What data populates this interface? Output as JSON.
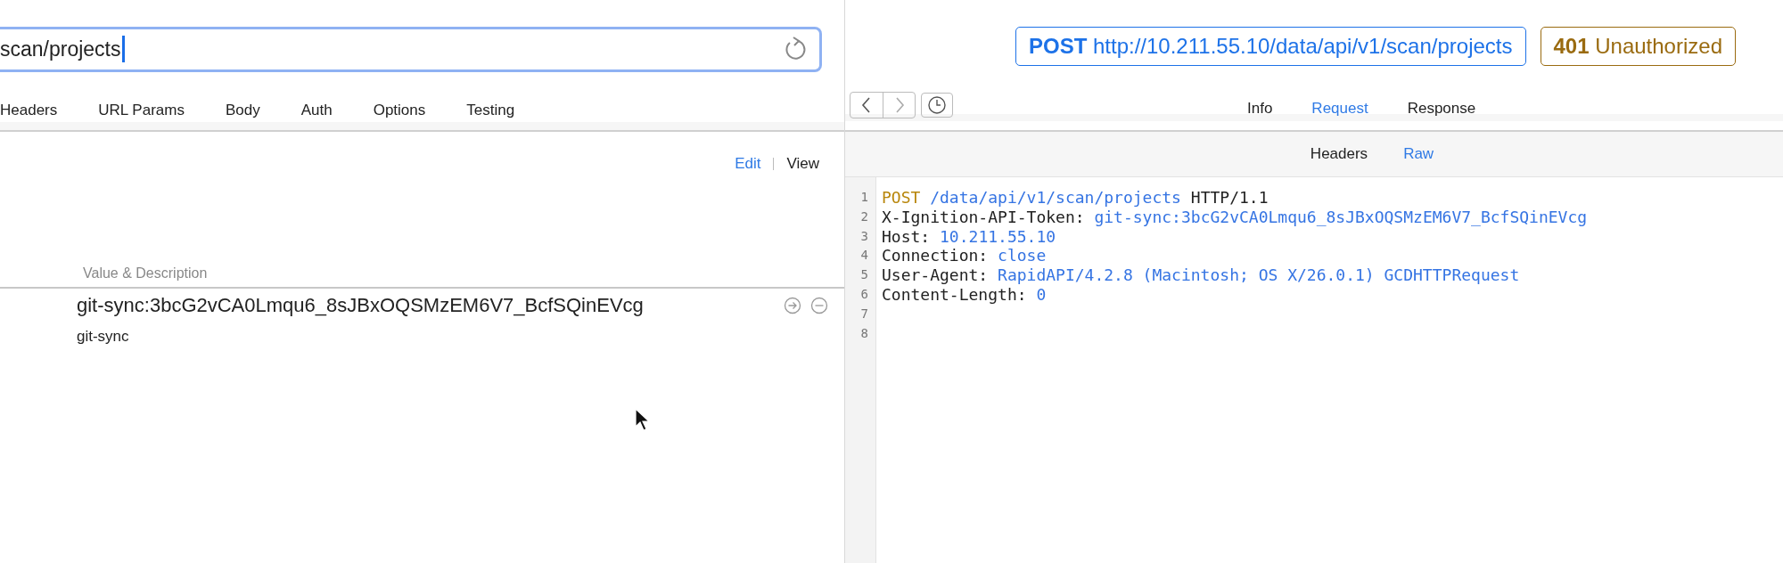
{
  "request": {
    "url_field": {
      "value": "scan/projects"
    },
    "tabs": [
      {
        "label": "Headers",
        "selected": false
      },
      {
        "label": "URL Params",
        "selected": false
      },
      {
        "label": "Body",
        "selected": false
      },
      {
        "label": "Auth",
        "selected": false
      },
      {
        "label": "Options",
        "selected": false
      },
      {
        "label": "Testing",
        "selected": false
      }
    ],
    "mode_switch": [
      {
        "label": "Edit",
        "selected": true
      },
      {
        "label": "View",
        "selected": false
      }
    ],
    "table": {
      "column_header": "Value & Description",
      "rows": [
        {
          "value": "git-sync:3bcG2vCA0Lmqu6_8sJBxOQSMzEM6V7_BcfSQinEVcg",
          "description": "git-sync"
        }
      ]
    }
  },
  "response": {
    "method": "POST",
    "url": "http://10.211.55.10/data/api/v1/scan/projects",
    "status_code": "401",
    "status_text": "Unauthorized",
    "tabs": [
      {
        "label": "Info",
        "selected": false
      },
      {
        "label": "Request",
        "selected": true
      },
      {
        "label": "Response",
        "selected": false
      }
    ],
    "subtabs": [
      {
        "label": "Headers",
        "selected": false
      },
      {
        "label": "Raw",
        "selected": true
      }
    ],
    "code_lines": [
      {
        "number": "1",
        "tokens": [
          {
            "kind": "method",
            "text": "POST"
          },
          {
            "kind": "value",
            "text": " /data/api/v1/scan/projects"
          },
          {
            "kind": "plain",
            "text": " HTTP/1.1"
          }
        ]
      },
      {
        "number": "2",
        "tokens": [
          {
            "kind": "plain",
            "text": "X-Ignition-API-Token: "
          },
          {
            "kind": "value",
            "text": "git-sync:3bcG2vCA0Lmqu6_8sJBxOQSMzEM6V7_BcfSQinEVcg"
          }
        ]
      },
      {
        "number": "3",
        "tokens": [
          {
            "kind": "plain",
            "text": "Host: "
          },
          {
            "kind": "value",
            "text": "10.211.55.10"
          }
        ]
      },
      {
        "number": "4",
        "tokens": [
          {
            "kind": "plain",
            "text": "Connection: "
          },
          {
            "kind": "value",
            "text": "close"
          }
        ]
      },
      {
        "number": "5",
        "tokens": [
          {
            "kind": "plain",
            "text": "User-Agent: "
          },
          {
            "kind": "value",
            "text": "RapidAPI/4.2.8 (Macintosh; OS X/26.0.1) GCDHTTPRequest"
          }
        ]
      },
      {
        "number": "6",
        "tokens": [
          {
            "kind": "plain",
            "text": "Content-Length: "
          },
          {
            "kind": "value",
            "text": "0"
          }
        ]
      },
      {
        "number": "7"
      },
      {
        "number": "8"
      }
    ]
  }
}
